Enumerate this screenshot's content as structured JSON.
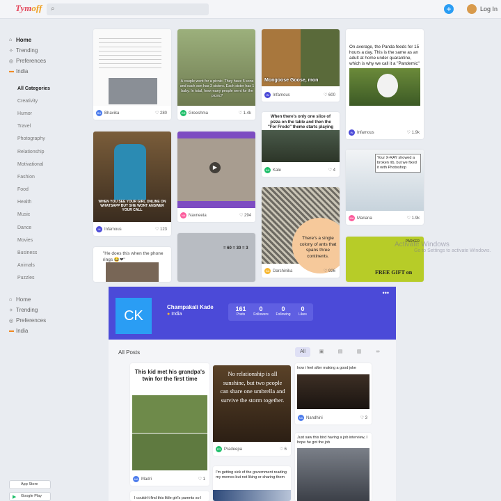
{
  "app": {
    "logo_main": "Tym",
    "logo_accent": "off",
    "login_label": "Log In",
    "plus_label": "+"
  },
  "sidebar_top": {
    "nav": [
      {
        "label": "Home",
        "icon": "house-icon",
        "glyph": "⌂"
      },
      {
        "label": "Trending",
        "icon": "trending-icon",
        "glyph": "✧"
      },
      {
        "label": "Preferences",
        "icon": "preferences-icon",
        "glyph": "◎"
      },
      {
        "label": "India",
        "icon": "india-flag-icon",
        "glyph": "▬"
      }
    ],
    "categories": [
      "All Categories",
      "Creativity",
      "Humor",
      "Travel",
      "Photography",
      "Relationship",
      "Motivational",
      "Fashion",
      "Food",
      "Health",
      "Music",
      "Dance",
      "Movies",
      "Business",
      "Animals",
      "Puzzles"
    ]
  },
  "sidebar_bottom": {
    "nav": [
      {
        "label": "Home",
        "glyph": "⌂"
      },
      {
        "label": "Trending",
        "glyph": "✧"
      },
      {
        "label": "Preferences",
        "glyph": "◎"
      },
      {
        "label": "India",
        "glyph": "▬"
      }
    ]
  },
  "cards": [
    {
      "author": "Bhavika",
      "likes": "280",
      "initials": "BH",
      "color": "#4b7bec"
    },
    {
      "author": "Greeshma",
      "likes": "1.4k",
      "initials": "GR",
      "color": "#20bf6b",
      "caption": "A couple went for a picnic. They have 5 sons and each son has 3 sisters. Each sister has 1 baby. In total, how many people went for the picnic?"
    },
    {
      "author": "Infamous",
      "likes": "600",
      "initials": "IN",
      "color": "#4b4ad8",
      "caption": "Mongoose      Goose, mon"
    },
    {
      "author": "Infamous",
      "likes": "1.9k",
      "initials": "IN",
      "color": "#4b4ad8",
      "caption": "On average, the Panda feeds for 15 hours a day. This is the same as an adult at home under quarantine, which is why we call it a \"Pandemic\""
    },
    {
      "author": "Infamous",
      "likes": "123",
      "initials": "IN",
      "color": "#4b4ad8",
      "caption": "WHEN YOU SEE YOUR GIRL ONLINE ON WHATSAPP BUT SHE WONT ANSWER YOUR CALL"
    },
    {
      "author": "Navneeta",
      "likes": "294",
      "initials": "NA",
      "color": "#fc5c9c"
    },
    {
      "author": "Kale",
      "likes": "4",
      "initials": "KA",
      "color": "#20bf6b",
      "caption": "When there's only one slice of pizza on the table and then the \"For Frodo\" theme starts playing"
    },
    {
      "author": "Manana",
      "likes": "1.9k",
      "initials": "MA",
      "color": "#fc5c9c",
      "caption": "Your X-RAY showed a broken rib, but we fixed it with Photoshop"
    },
    {
      "author": "Darshinika",
      "likes": "926",
      "initials": "DA",
      "color": "#f7b731",
      "caption": "There's a single colony of ants that spans three continents."
    },
    {
      "caption": "\"He does this when the phone rings 😂❤\""
    },
    {
      "caption": "FREE GIFT on",
      "label": "PARKER"
    },
    {
      "caption": "= 60   = 30   = 3"
    }
  ],
  "profile": {
    "initials": "CK",
    "name": "Champakali Kade",
    "location": "India",
    "stats": [
      {
        "n": "161",
        "l": "Posts"
      },
      {
        "n": "0",
        "l": "Followers"
      },
      {
        "n": "0",
        "l": "Following"
      },
      {
        "n": "0",
        "l": "Likes"
      }
    ],
    "more": "•••"
  },
  "posts": {
    "title": "All Posts",
    "filter_all": "All",
    "items": [
      {
        "caption": "This kid met his grandpa's twin for the first time",
        "author": "Madri",
        "likes": "1",
        "initials": "MA",
        "color": "#4b7bec"
      },
      {
        "caption": "No relationship is all sunshine, but two people can share one umbrella and survive the storm together.",
        "author": "Pradeepa",
        "likes": "6",
        "initials": "PR",
        "color": "#20bf6b"
      },
      {
        "caption": "how i feel after making a good joke",
        "author": "Nandhini",
        "likes": "3",
        "initials": "NA",
        "color": "#4b7bec"
      },
      {
        "caption": "I'm getting sick of the government reading my memes but not liking or sharing them"
      },
      {
        "caption": "Just saw this bird having a job interview, I hope he got the job"
      },
      {
        "caption": "I couldn't find this little girl's parents so I"
      }
    ]
  },
  "stores": [
    "App Store",
    "Google Play"
  ],
  "watermark": {
    "line1": "Activate Windows",
    "line2": "Go to Settings to activate Windows."
  }
}
